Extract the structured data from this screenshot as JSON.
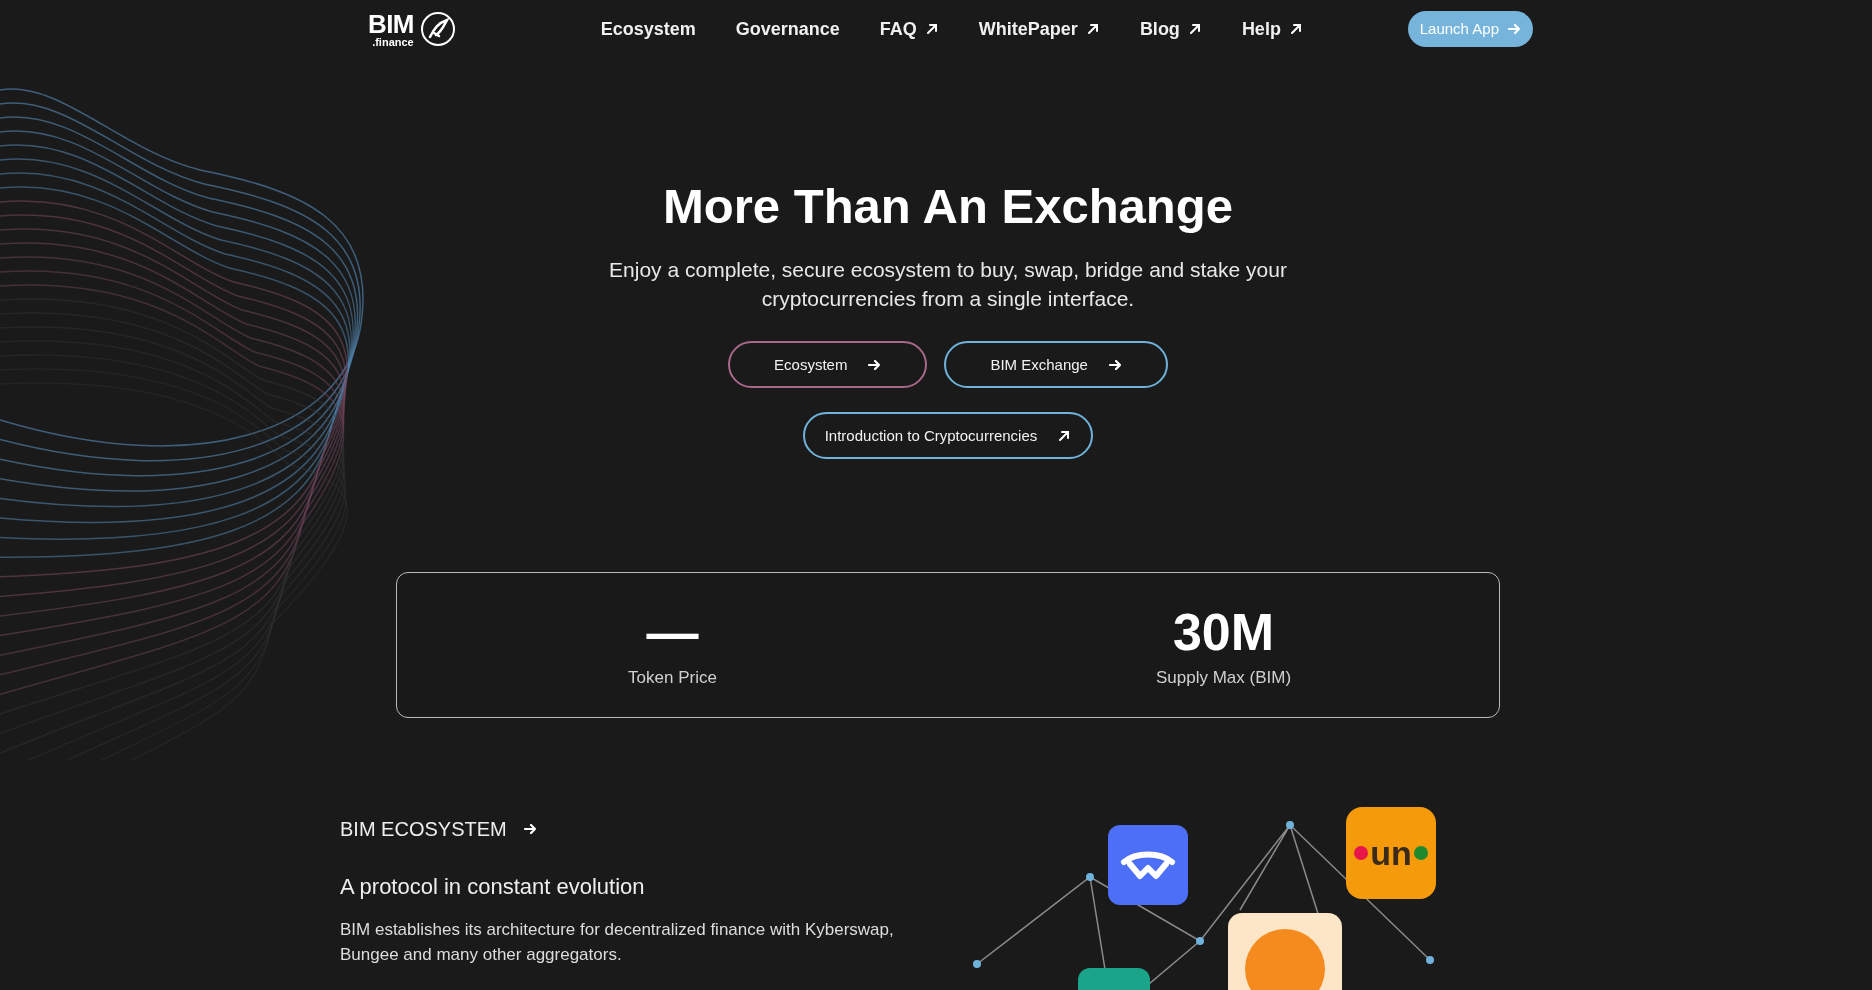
{
  "header": {
    "logo": {
      "wordmark": "BIM",
      "suffix": ".finance"
    },
    "nav": [
      {
        "label": "Ecosystem",
        "external": false
      },
      {
        "label": "Governance",
        "external": false
      },
      {
        "label": "FAQ",
        "external": true
      },
      {
        "label": "WhitePaper",
        "external": true
      },
      {
        "label": "Blog",
        "external": true
      },
      {
        "label": "Help",
        "external": true
      }
    ],
    "launch_button": "Launch App"
  },
  "hero": {
    "title": "More Than An Exchange",
    "subtitle": "Enjoy a complete, secure ecosystem to buy, swap, bridge and stake your cryptocurrencies from a single interface.",
    "buttons": [
      {
        "label": "Ecosystem",
        "kind": "internal",
        "color": "#a8688a"
      },
      {
        "label": "BIM Exchange",
        "kind": "internal",
        "color": "#6fb3dc"
      },
      {
        "label": "Introduction to Cryptocurrencies",
        "kind": "external",
        "color": "#6fb3dc"
      }
    ]
  },
  "stats": [
    {
      "value": "—",
      "label": "Token Price"
    },
    {
      "value": "30M",
      "label": "Supply Max (BIM)"
    }
  ],
  "ecosystem": {
    "link": "BIM ECOSYSTEM",
    "heading": "A protocol in constant evolution",
    "text": "BIM establishes its architecture for decentralized finance with Kyberswap, Bungee and many other aggregators.",
    "partner_logo_text": "un"
  }
}
